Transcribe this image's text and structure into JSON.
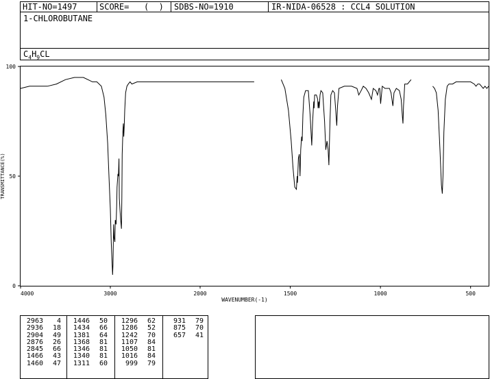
{
  "header": {
    "hit_no": "HIT-NO=1497",
    "score_label": "SCORE=",
    "score_value": "(  )",
    "sdbs_no": "SDBS-NO=1910",
    "ir_info": "IR-NIDA-06528 : CCL4 SOLUTION",
    "compound_name": "1-CHLOROBUTANE",
    "formula": {
      "c": "C",
      "c_count": "4",
      "h": "H",
      "h_count": "9",
      "rest": "CL"
    }
  },
  "chart_data": {
    "type": "line",
    "xlabel": "WAVENUMBER(-1)",
    "ylabel": "TRANSMITTANCE(%)",
    "xlim": [
      4000,
      400
    ],
    "ylim": [
      0,
      100
    ],
    "x_ticks": [
      4000,
      3000,
      2000,
      1500,
      1000,
      500
    ],
    "y_ticks": [
      0,
      50,
      100
    ],
    "grid": false,
    "line_color": "#000000",
    "segments": [
      [
        [
          4000,
          90
        ],
        [
          3900,
          91
        ],
        [
          3800,
          91
        ],
        [
          3700,
          91
        ],
        [
          3600,
          92
        ],
        [
          3500,
          94
        ],
        [
          3400,
          95
        ],
        [
          3300,
          95
        ],
        [
          3250,
          94
        ],
        [
          3200,
          93
        ],
        [
          3150,
          93
        ],
        [
          3100,
          91
        ],
        [
          3070,
          86
        ],
        [
          3050,
          78
        ],
        [
          3030,
          65
        ],
        [
          3015,
          50
        ],
        [
          3000,
          35
        ],
        [
          2990,
          20
        ],
        [
          2980,
          10
        ],
        [
          2975,
          5
        ],
        [
          2970,
          10
        ],
        [
          2963,
          28
        ],
        [
          2958,
          22
        ],
        [
          2950,
          20
        ],
        [
          2945,
          30
        ],
        [
          2936,
          28
        ],
        [
          2930,
          36
        ],
        [
          2925,
          45
        ],
        [
          2915,
          51
        ],
        [
          2910,
          50
        ],
        [
          2904,
          58
        ],
        [
          2900,
          40
        ],
        [
          2893,
          35
        ],
        [
          2885,
          30
        ],
        [
          2876,
          26
        ],
        [
          2872,
          40
        ],
        [
          2868,
          60
        ],
        [
          2860,
          70
        ],
        [
          2855,
          74
        ],
        [
          2850,
          68
        ],
        [
          2845,
          73
        ],
        [
          2840,
          80
        ],
        [
          2830,
          88
        ],
        [
          2815,
          91
        ],
        [
          2800,
          92
        ],
        [
          2780,
          93
        ],
        [
          2760,
          92
        ],
        [
          2700,
          93
        ],
        [
          2600,
          93
        ],
        [
          2400,
          93
        ],
        [
          2200,
          93
        ],
        [
          2000,
          93
        ],
        [
          1800,
          93
        ],
        [
          1700,
          93
        ]
      ],
      [
        [
          1550,
          94
        ],
        [
          1530,
          90
        ],
        [
          1510,
          80
        ],
        [
          1495,
          66
        ],
        [
          1485,
          54
        ],
        [
          1475,
          45
        ],
        [
          1466,
          44
        ],
        [
          1462,
          50
        ],
        [
          1460,
          47
        ],
        [
          1455,
          58
        ],
        [
          1450,
          60
        ],
        [
          1446,
          50
        ],
        [
          1442,
          62
        ],
        [
          1437,
          68
        ],
        [
          1434,
          66
        ],
        [
          1430,
          78
        ],
        [
          1425,
          86
        ],
        [
          1415,
          89
        ],
        [
          1400,
          89
        ],
        [
          1390,
          78
        ],
        [
          1381,
          64
        ],
        [
          1376,
          75
        ],
        [
          1370,
          84
        ],
        [
          1368,
          81
        ],
        [
          1365,
          87
        ],
        [
          1355,
          87
        ],
        [
          1348,
          85
        ],
        [
          1346,
          81
        ],
        [
          1342,
          84
        ],
        [
          1340,
          81
        ],
        [
          1335,
          87
        ],
        [
          1330,
          89
        ],
        [
          1320,
          88
        ],
        [
          1310,
          75
        ],
        [
          1303,
          62
        ],
        [
          1296,
          66
        ],
        [
          1290,
          62
        ],
        [
          1286,
          55
        ],
        [
          1280,
          75
        ],
        [
          1275,
          87
        ],
        [
          1265,
          89
        ],
        [
          1255,
          88
        ],
        [
          1248,
          80
        ],
        [
          1242,
          73
        ],
        [
          1238,
          82
        ],
        [
          1230,
          90
        ],
        [
          1200,
          91
        ],
        [
          1160,
          91
        ],
        [
          1130,
          90
        ],
        [
          1120,
          87
        ],
        [
          1107,
          89
        ],
        [
          1095,
          91
        ],
        [
          1080,
          90
        ],
        [
          1065,
          88
        ],
        [
          1050,
          85
        ],
        [
          1040,
          90
        ],
        [
          1025,
          89
        ],
        [
          1016,
          87
        ],
        [
          1008,
          90
        ],
        [
          1004,
          90
        ],
        [
          999,
          83
        ],
        [
          990,
          91
        ],
        [
          975,
          90
        ],
        [
          960,
          90
        ],
        [
          950,
          90
        ],
        [
          941,
          88
        ],
        [
          931,
          82
        ],
        [
          925,
          88
        ],
        [
          912,
          90
        ],
        [
          895,
          89
        ],
        [
          885,
          85
        ],
        [
          878,
          77
        ],
        [
          875,
          74
        ],
        [
          872,
          82
        ],
        [
          865,
          92
        ],
        [
          850,
          92
        ],
        [
          840,
          93
        ],
        [
          830,
          94
        ]
      ],
      [
        [
          710,
          91
        ],
        [
          700,
          90
        ],
        [
          690,
          88
        ],
        [
          680,
          80
        ],
        [
          670,
          62
        ],
        [
          662,
          46
        ],
        [
          657,
          42
        ],
        [
          653,
          50
        ],
        [
          648,
          70
        ],
        [
          640,
          85
        ],
        [
          630,
          91
        ],
        [
          620,
          92
        ],
        [
          600,
          92
        ],
        [
          580,
          93
        ],
        [
          550,
          93
        ],
        [
          500,
          93
        ],
        [
          480,
          92
        ],
        [
          470,
          91
        ],
        [
          460,
          92
        ],
        [
          450,
          92
        ],
        [
          440,
          91
        ],
        [
          430,
          90
        ],
        [
          420,
          91
        ],
        [
          410,
          90
        ],
        [
          400,
          91
        ]
      ]
    ]
  },
  "peaks": [
    [
      [
        "2963",
        "4"
      ],
      [
        "2936",
        "18"
      ],
      [
        "2904",
        "49"
      ],
      [
        "2876",
        "26"
      ],
      [
        "2845",
        "66"
      ],
      [
        "1466",
        "43"
      ],
      [
        "1460",
        "47"
      ]
    ],
    [
      [
        "1446",
        "50"
      ],
      [
        "1434",
        "66"
      ],
      [
        "1381",
        "64"
      ],
      [
        "1368",
        "81"
      ],
      [
        "1346",
        "81"
      ],
      [
        "1340",
        "81"
      ],
      [
        "1311",
        "60"
      ]
    ],
    [
      [
        "1296",
        "62"
      ],
      [
        "1286",
        "52"
      ],
      [
        "1242",
        "70"
      ],
      [
        "1107",
        "84"
      ],
      [
        "1050",
        "81"
      ],
      [
        "1016",
        "84"
      ],
      [
        "999",
        "79"
      ]
    ],
    [
      [
        "931",
        "79"
      ],
      [
        "875",
        "70"
      ],
      [
        "657",
        "41"
      ]
    ]
  ]
}
